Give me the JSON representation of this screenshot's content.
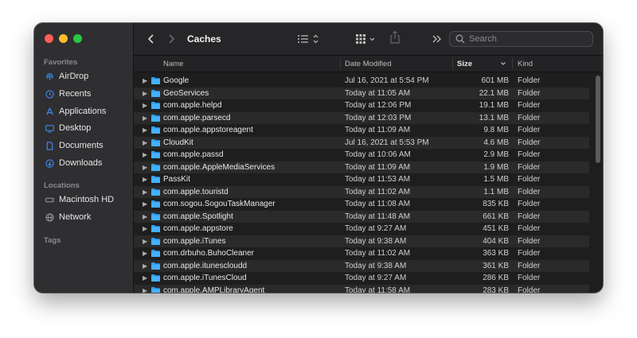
{
  "window": {
    "title": "Caches"
  },
  "sidebar": {
    "favorites_label": "Favorites",
    "locations_label": "Locations",
    "tags_label": "Tags",
    "favorites": [
      {
        "label": "AirDrop",
        "icon": "airdrop-icon"
      },
      {
        "label": "Recents",
        "icon": "clock-icon"
      },
      {
        "label": "Applications",
        "icon": "applications-icon"
      },
      {
        "label": "Desktop",
        "icon": "desktop-icon"
      },
      {
        "label": "Documents",
        "icon": "document-icon"
      },
      {
        "label": "Downloads",
        "icon": "download-icon"
      }
    ],
    "locations": [
      {
        "label": "Macintosh HD",
        "icon": "hard-drive-icon"
      },
      {
        "label": "Network",
        "icon": "globe-icon"
      }
    ]
  },
  "toolbar": {
    "search_placeholder": "Search"
  },
  "columns": {
    "name": "Name",
    "date_modified": "Date Modified",
    "size": "Size",
    "kind": "Kind"
  },
  "files": [
    {
      "name": "Google",
      "date": "Jul 16, 2021 at 5:54 PM",
      "size": "601 MB",
      "kind": "Folder"
    },
    {
      "name": "GeoServices",
      "date": "Today at 11:05 AM",
      "size": "22.1 MB",
      "kind": "Folder"
    },
    {
      "name": "com.apple.helpd",
      "date": "Today at 12:06 PM",
      "size": "19.1 MB",
      "kind": "Folder"
    },
    {
      "name": "com.apple.parsecd",
      "date": "Today at 12:03 PM",
      "size": "13.1 MB",
      "kind": "Folder"
    },
    {
      "name": "com.apple.appstoreagent",
      "date": "Today at 11:09 AM",
      "size": "9.8 MB",
      "kind": "Folder"
    },
    {
      "name": "CloudKit",
      "date": "Jul 16, 2021 at 5:53 PM",
      "size": "4.6 MB",
      "kind": "Folder"
    },
    {
      "name": "com.apple.passd",
      "date": "Today at 10:06 AM",
      "size": "2.9 MB",
      "kind": "Folder"
    },
    {
      "name": "com.apple.AppleMediaServices",
      "date": "Today at 11:09 AM",
      "size": "1.9 MB",
      "kind": "Folder"
    },
    {
      "name": "PassKit",
      "date": "Today at 11:53 AM",
      "size": "1.5 MB",
      "kind": "Folder"
    },
    {
      "name": "com.apple.touristd",
      "date": "Today at 11:02 AM",
      "size": "1.1 MB",
      "kind": "Folder"
    },
    {
      "name": "com.sogou.SogouTaskManager",
      "date": "Today at 11:08 AM",
      "size": "835 KB",
      "kind": "Folder"
    },
    {
      "name": "com.apple.Spotlight",
      "date": "Today at 11:48 AM",
      "size": "661 KB",
      "kind": "Folder"
    },
    {
      "name": "com.apple.appstore",
      "date": "Today at 9:27 AM",
      "size": "451 KB",
      "kind": "Folder"
    },
    {
      "name": "com.apple.iTunes",
      "date": "Today at 9:38 AM",
      "size": "404 KB",
      "kind": "Folder"
    },
    {
      "name": "com.drbuho.BuhoCleaner",
      "date": "Today at 11:02 AM",
      "size": "363 KB",
      "kind": "Folder"
    },
    {
      "name": "com.apple.itunescloudd",
      "date": "Today at 9:38 AM",
      "size": "361 KB",
      "kind": "Folder"
    },
    {
      "name": "com.apple.iTunesCloud",
      "date": "Today at 9:27 AM",
      "size": "286 KB",
      "kind": "Folder"
    },
    {
      "name": "com.apple.AMPLibraryAgent",
      "date": "Today at 11:58 AM",
      "size": "283 KB",
      "kind": "Folder"
    }
  ]
}
